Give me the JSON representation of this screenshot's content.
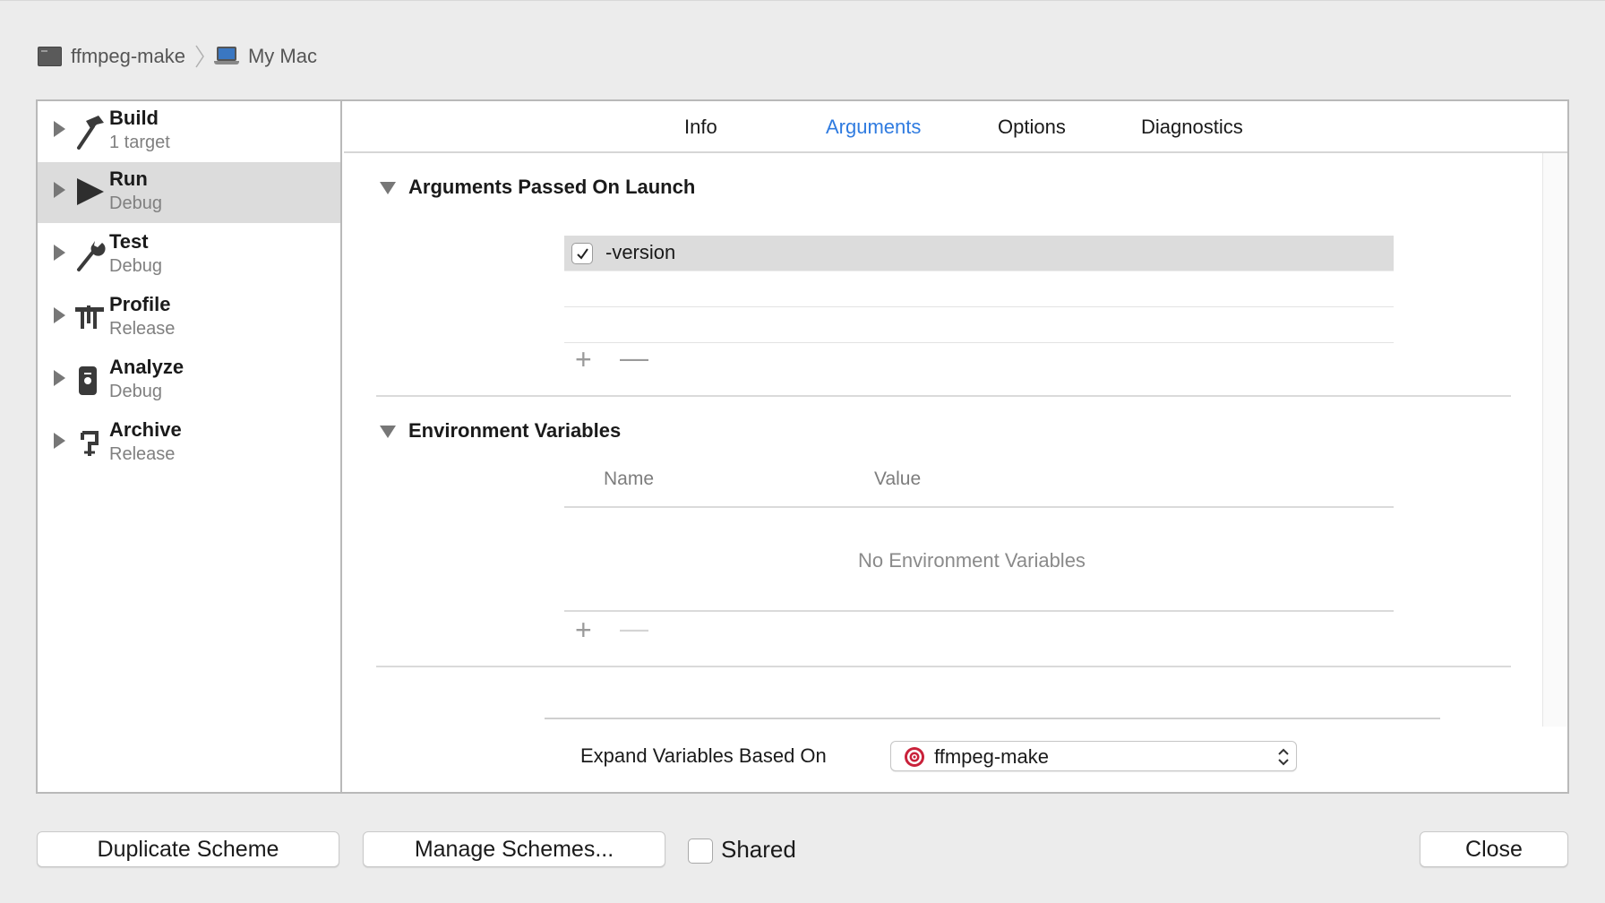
{
  "breadcrumb": {
    "project": "ffmpeg-make",
    "destination": "My Mac",
    "project_icon": "terminal-icon",
    "destination_icon": "macbook-icon"
  },
  "sidebar": {
    "items": [
      {
        "title": "Build",
        "subtitle": "1 target",
        "icon": "hammer-icon",
        "selected": false
      },
      {
        "title": "Run",
        "subtitle": "Debug",
        "icon": "play-icon",
        "selected": true
      },
      {
        "title": "Test",
        "subtitle": "Debug",
        "icon": "wrench-icon",
        "selected": false
      },
      {
        "title": "Profile",
        "subtitle": "Release",
        "icon": "gauge-icon",
        "selected": false
      },
      {
        "title": "Analyze",
        "subtitle": "Debug",
        "icon": "analyze-icon",
        "selected": false
      },
      {
        "title": "Archive",
        "subtitle": "Release",
        "icon": "archive-icon",
        "selected": false
      }
    ]
  },
  "tabs": [
    {
      "label": "Info",
      "active": false
    },
    {
      "label": "Arguments",
      "active": true
    },
    {
      "label": "Options",
      "active": false
    },
    {
      "label": "Diagnostics",
      "active": false
    }
  ],
  "arguments_section": {
    "title": "Arguments Passed On Launch",
    "rows": [
      {
        "checked": true,
        "value": "-version"
      }
    ],
    "add_label": "+",
    "remove_label": "—"
  },
  "env_section": {
    "title": "Environment Variables",
    "columns": [
      "Name",
      "Value"
    ],
    "empty_message": "No Environment Variables",
    "add_label": "+",
    "remove_label": "—"
  },
  "expand": {
    "label": "Expand Variables Based On",
    "selected": "ffmpeg-make",
    "icon": "target-icon"
  },
  "buttons": {
    "duplicate": "Duplicate Scheme",
    "manage": "Manage Schemes...",
    "shared_label": "Shared",
    "shared_checked": false,
    "close": "Close"
  },
  "colors": {
    "accent": "#2f7be0",
    "selected_row": "#dcdcdc",
    "window_bg": "#ececec"
  }
}
